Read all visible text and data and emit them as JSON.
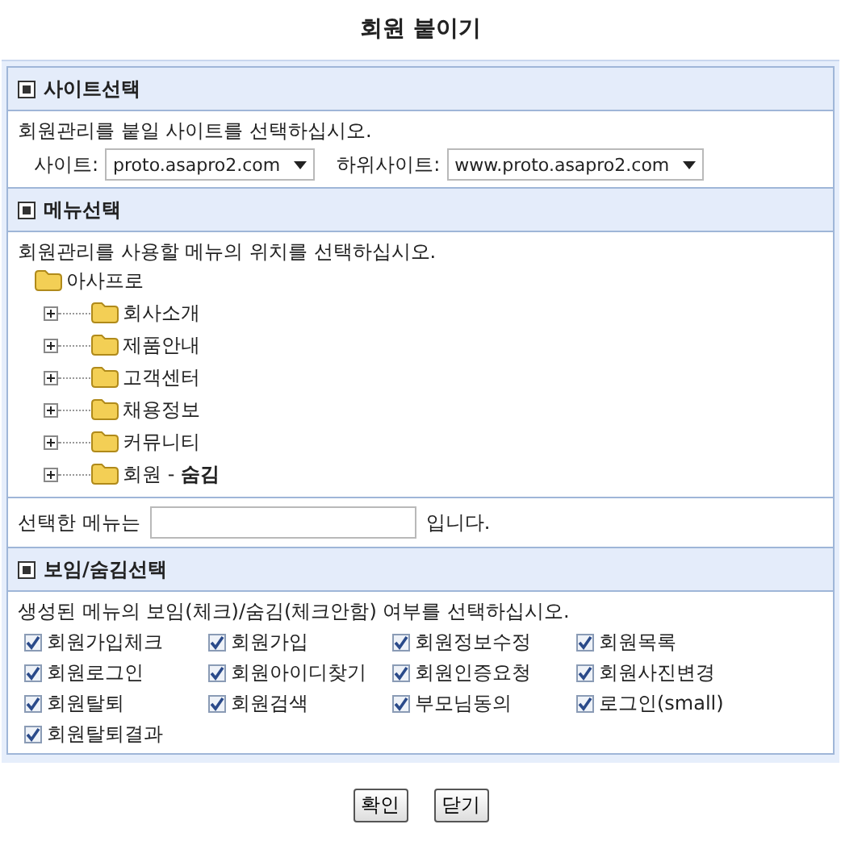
{
  "title": "회원 붙이기",
  "site_section": {
    "heading": "사이트선택",
    "description": "회원관리를 붙일 사이트를 선택하십시오.",
    "site_label": "사이트:",
    "site_value": "proto.asapro2.com",
    "subsite_label": "하위사이트:",
    "subsite_value": "www.proto.asapro2.com"
  },
  "menu_section": {
    "heading": "메뉴선택",
    "description": "회원관리를 사용할 메뉴의 위치를 선택하십시오.",
    "tree": {
      "label": "아사프로",
      "children": [
        {
          "label": "회사소개",
          "expanded": false
        },
        {
          "label": "제품안내",
          "expanded": false
        },
        {
          "label": "고객센터",
          "expanded": false
        },
        {
          "label": "채용정보",
          "expanded": false
        },
        {
          "label": "커뮤니티",
          "expanded": false
        },
        {
          "label": "회원 - **숨김**",
          "expanded": false
        }
      ]
    },
    "selected_prefix": "선택한 메뉴는",
    "selected_suffix": "입니다."
  },
  "visibility_section": {
    "heading": "보임/숨김선택",
    "description": "생성된 메뉴의 보임(체크)/숨김(체크안함) 여부를 선택하십시오.",
    "options": [
      {
        "label": "회원가입체크",
        "checked": true
      },
      {
        "label": "회원가입",
        "checked": true
      },
      {
        "label": "회원정보수정",
        "checked": true
      },
      {
        "label": "회원목록",
        "checked": true
      },
      {
        "label": "회원로그인",
        "checked": true
      },
      {
        "label": "회원아이디찾기",
        "checked": true
      },
      {
        "label": "회원인증요청",
        "checked": true
      },
      {
        "label": "회원사진변경",
        "checked": true
      },
      {
        "label": "회원탈퇴",
        "checked": true
      },
      {
        "label": "회원검색",
        "checked": true
      },
      {
        "label": "부모님동의",
        "checked": true
      },
      {
        "label": "로그인(small)",
        "checked": true
      },
      {
        "label": "회원탈퇴결과",
        "checked": true
      }
    ]
  },
  "buttons": [
    "확인",
    "닫기"
  ]
}
